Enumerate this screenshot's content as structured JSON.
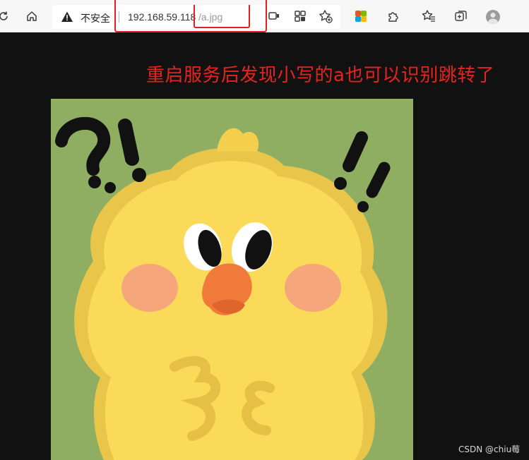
{
  "toolbar": {
    "security_label": "不安全",
    "url_host": "192.168.59.118",
    "url_path": "/a.jpg",
    "icons": [
      "reload-icon",
      "home-icon",
      "warning-icon",
      "read-aloud-icon",
      "app-grid-icon",
      "favorite-add-icon",
      "extension-colorful-icon",
      "extensions-icon",
      "favorites-icon",
      "collections-icon",
      "profile-avatar"
    ]
  },
  "annotation": {
    "text": "重启服务后发现小写的a也可以识别跳转了",
    "color": "#e8231c"
  },
  "image": {
    "subject": "yellow chick illustration",
    "background_color": "#8fae62"
  },
  "watermark": {
    "text": "CSDN @chiu莓"
  }
}
